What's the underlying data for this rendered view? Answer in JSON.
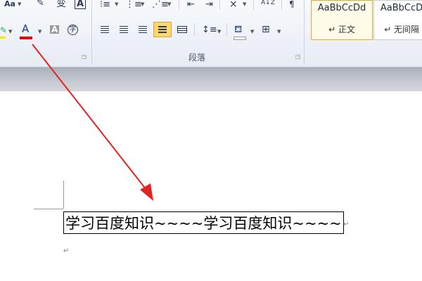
{
  "ribbon": {
    "font_group": {
      "font_size_aa": "Aa",
      "change_case_glyph": "变",
      "font_color_glyph": "A",
      "char_shading_glyph": "A",
      "enclose_char_glyph": "字"
    },
    "paragraph_group": {
      "label": "段落",
      "sort_glyph": "A↓Z"
    },
    "styles_group": {
      "styles": [
        {
          "sample": "AaBbCcDd",
          "name": "↵ 正文",
          "active": true
        },
        {
          "sample": "AaBbCcD",
          "name": "↵ 无间隔",
          "active": false
        }
      ]
    }
  },
  "document": {
    "text": "学习百度知识~~~~学习百度知识~~~~",
    "paragraph_mark": "↵"
  },
  "colors": {
    "arrow": "#e32222",
    "font_color_underline": "#e00000",
    "highlight_underline": "#ffe800",
    "active_button": "#ffd86b"
  }
}
